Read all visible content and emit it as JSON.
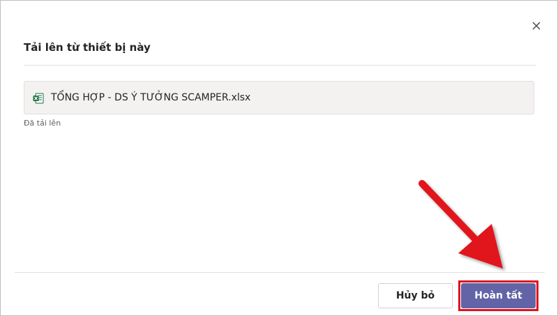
{
  "dialog": {
    "title": "Tải lên từ thiết bị này",
    "close_icon": "close-icon"
  },
  "file": {
    "icon": "excel-file-icon",
    "icon_color": "#1d6f42",
    "name": "TỔNG HỢP - DS Ý TƯỞNG SCAMPER.xlsx",
    "status": "Đã tải lên"
  },
  "footer": {
    "cancel_label": "Hủy bỏ",
    "done_label": "Hoàn tất",
    "primary_color": "#6264a7",
    "highlight_color": "#e0121b"
  }
}
